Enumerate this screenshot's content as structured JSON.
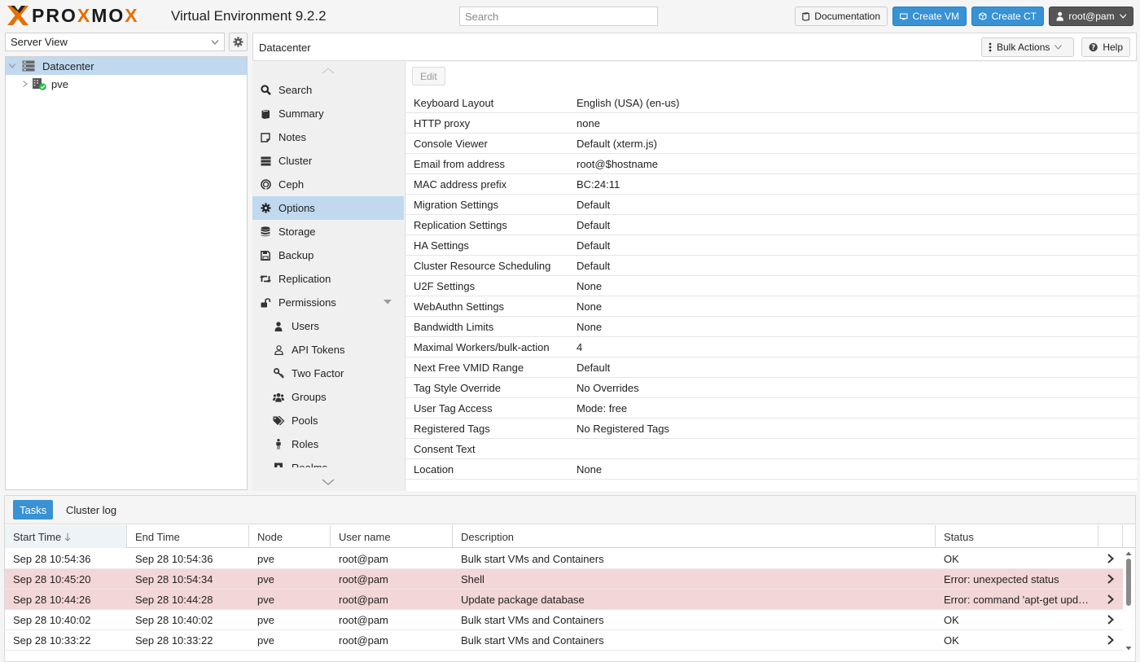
{
  "app": {
    "brand": "PROXMOX",
    "title": "Virtual Environment 9.2.2"
  },
  "header": {
    "search_placeholder": "Search",
    "documentation": "Documentation",
    "create_vm": "Create VM",
    "create_ct": "Create CT",
    "user": "root@pam"
  },
  "tree": {
    "view": "Server View",
    "items": [
      {
        "label": "Datacenter",
        "icon": "datacenter-icon"
      },
      {
        "label": "pve",
        "icon": "node-online-icon"
      }
    ]
  },
  "content": {
    "title": "Datacenter",
    "bulk_actions": "Bulk Actions",
    "help": "Help",
    "edit": "Edit"
  },
  "nav": {
    "items": [
      {
        "label": "Search",
        "icon": "search-icon"
      },
      {
        "label": "Summary",
        "icon": "book-icon"
      },
      {
        "label": "Notes",
        "icon": "notes-icon"
      },
      {
        "label": "Cluster",
        "icon": "server-icon"
      },
      {
        "label": "Ceph",
        "icon": "ceph-icon"
      },
      {
        "label": "Options",
        "icon": "gear-icon"
      },
      {
        "label": "Storage",
        "icon": "database-icon"
      },
      {
        "label": "Backup",
        "icon": "floppy-icon"
      },
      {
        "label": "Replication",
        "icon": "retweet-icon"
      },
      {
        "label": "Permissions",
        "icon": "unlock-icon"
      },
      {
        "label": "Users",
        "icon": "user-icon"
      },
      {
        "label": "API Tokens",
        "icon": "user-outline-icon"
      },
      {
        "label": "Two Factor",
        "icon": "key-icon"
      },
      {
        "label": "Groups",
        "icon": "users-icon"
      },
      {
        "label": "Pools",
        "icon": "tags-icon"
      },
      {
        "label": "Roles",
        "icon": "male-icon"
      },
      {
        "label": "Realms",
        "icon": "address-book-icon"
      }
    ]
  },
  "options": [
    {
      "key": "Keyboard Layout",
      "value": "English (USA) (en-us)"
    },
    {
      "key": "HTTP proxy",
      "value": "none"
    },
    {
      "key": "Console Viewer",
      "value": "Default (xterm.js)"
    },
    {
      "key": "Email from address",
      "value": "root@$hostname"
    },
    {
      "key": "MAC address prefix",
      "value": "BC:24:11"
    },
    {
      "key": "Migration Settings",
      "value": "Default"
    },
    {
      "key": "Replication Settings",
      "value": "Default"
    },
    {
      "key": "HA Settings",
      "value": "Default"
    },
    {
      "key": "Cluster Resource Scheduling",
      "value": "Default"
    },
    {
      "key": "U2F Settings",
      "value": "None"
    },
    {
      "key": "WebAuthn Settings",
      "value": "None"
    },
    {
      "key": "Bandwidth Limits",
      "value": "None"
    },
    {
      "key": "Maximal Workers/bulk-action",
      "value": "4"
    },
    {
      "key": "Next Free VMID Range",
      "value": "Default"
    },
    {
      "key": "Tag Style Override",
      "value": "No Overrides"
    },
    {
      "key": "User Tag Access",
      "value": "Mode: free"
    },
    {
      "key": "Registered Tags",
      "value": "No Registered Tags"
    },
    {
      "key": "Consent Text",
      "value": ""
    },
    {
      "key": "Location",
      "value": "None"
    }
  ],
  "bottom": {
    "tabs": [
      "Tasks",
      "Cluster log"
    ],
    "columns": [
      "Start Time",
      "End Time",
      "Node",
      "User name",
      "Description",
      "Status"
    ],
    "rows": [
      {
        "start": "Sep 28 10:54:36",
        "end": "Sep 28 10:54:36",
        "node": "pve",
        "user": "root@pam",
        "desc": "Bulk start VMs and Containers",
        "status": "OK",
        "error": false
      },
      {
        "start": "Sep 28 10:45:20",
        "end": "Sep 28 10:54:34",
        "node": "pve",
        "user": "root@pam",
        "desc": "Shell",
        "status": "Error: unexpected status",
        "error": true
      },
      {
        "start": "Sep 28 10:44:26",
        "end": "Sep 28 10:44:28",
        "node": "pve",
        "user": "root@pam",
        "desc": "Update package database",
        "status": "Error: command 'apt-get upd…",
        "error": true
      },
      {
        "start": "Sep 28 10:40:02",
        "end": "Sep 28 10:40:02",
        "node": "pve",
        "user": "root@pam",
        "desc": "Bulk start VMs and Containers",
        "status": "OK",
        "error": false
      },
      {
        "start": "Sep 28 10:33:22",
        "end": "Sep 28 10:33:22",
        "node": "pve",
        "user": "root@pam",
        "desc": "Bulk start VMs and Containers",
        "status": "OK",
        "error": false
      }
    ]
  },
  "colors": {
    "accent": "#e57000",
    "primary": "#3892d4",
    "selection": "#c0d9ef",
    "error_row": "#f3d6d7"
  }
}
